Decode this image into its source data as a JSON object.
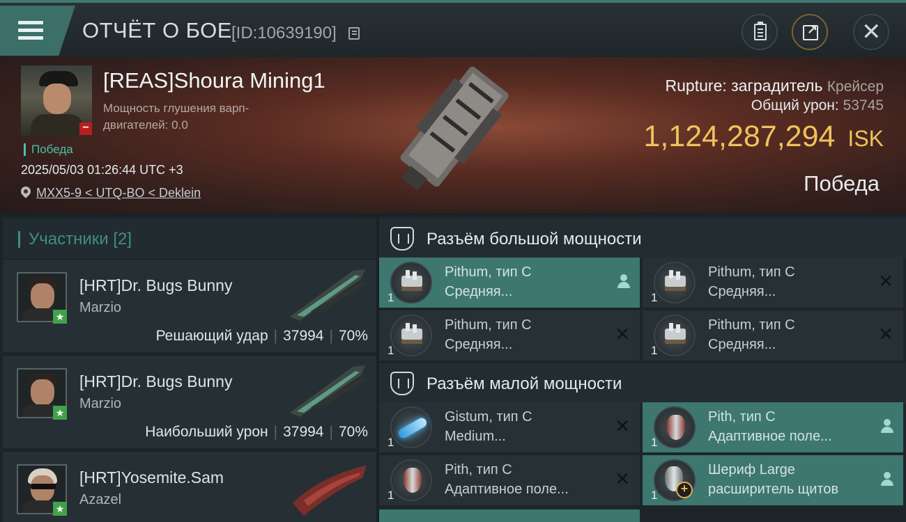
{
  "header": {
    "title": "ОТЧЁТ О БОЕ",
    "report_id": "[ID:10639190]",
    "icons": [
      "menu-icon",
      "copy-icon",
      "clipboard-icon",
      "share-icon",
      "close-icon"
    ]
  },
  "victim": {
    "name": "[REAS]Shoura Mining1",
    "warp_disruption_label": "Мощность глушения варп-двигателей: 0.0",
    "result": "Победа",
    "datetime": "2025/05/03 01:26:44 UTC +3",
    "location": "MXX5-9 < UTQ-BO < Deklein",
    "ship_name": "Rupture: заградитель",
    "ship_class": "Крейсер",
    "total_damage_label": "Общий урон:",
    "total_damage": "53745",
    "isk_value": "1,124,287,294",
    "isk_unit": "ISK",
    "outcome": "Победа"
  },
  "participants": {
    "header": "Участники [2]",
    "items": [
      {
        "name": "[HRT]Dr. Bugs Bunny",
        "ship": "Marzio",
        "role": "Решающий удар",
        "damage": "37994",
        "percent": "70%"
      },
      {
        "name": "[HRT]Dr. Bugs Bunny",
        "ship": "Marzio",
        "role": "Наибольший урон",
        "damage": "37994",
        "percent": "70%"
      },
      {
        "name": "[HRT]Yosemite.Sam",
        "ship": "Azazel"
      }
    ]
  },
  "fitting": {
    "high_slots": {
      "title": "Разъём большой мощности",
      "modules": [
        {
          "name": "Pithum, тип C",
          "desc": "Средняя...",
          "qty": "1",
          "status": "person",
          "highlight": true
        },
        {
          "name": "Pithum, тип C",
          "desc": "Средняя...",
          "qty": "1",
          "status": "cross"
        },
        {
          "name": "Pithum, тип C",
          "desc": "Средняя...",
          "qty": "1",
          "status": "cross"
        },
        {
          "name": "Pithum, тип C",
          "desc": "Средняя...",
          "qty": "1",
          "status": "cross"
        }
      ]
    },
    "low_slots": {
      "title": "Разъём малой мощности",
      "modules": [
        {
          "name": "Gistum, тип C",
          "desc": "Medium...",
          "qty": "1",
          "status": "cross"
        },
        {
          "name": "Pith, тип C",
          "desc": "Адаптивное поле...",
          "qty": "1",
          "status": "person",
          "highlight": true
        },
        {
          "name": "Pith, тип C",
          "desc": "Адаптивное поле...",
          "qty": "1",
          "status": "cross"
        },
        {
          "name": "Шериф Large",
          "desc": "расширитель щитов",
          "qty": "1",
          "status": "person",
          "highlight": true
        }
      ]
    }
  },
  "colors": {
    "accent": "#3d7770",
    "isk": "#f0c25a",
    "victory": "#4fbea7",
    "badge_red": "#b81e1e",
    "badge_green": "#3fa34d"
  }
}
